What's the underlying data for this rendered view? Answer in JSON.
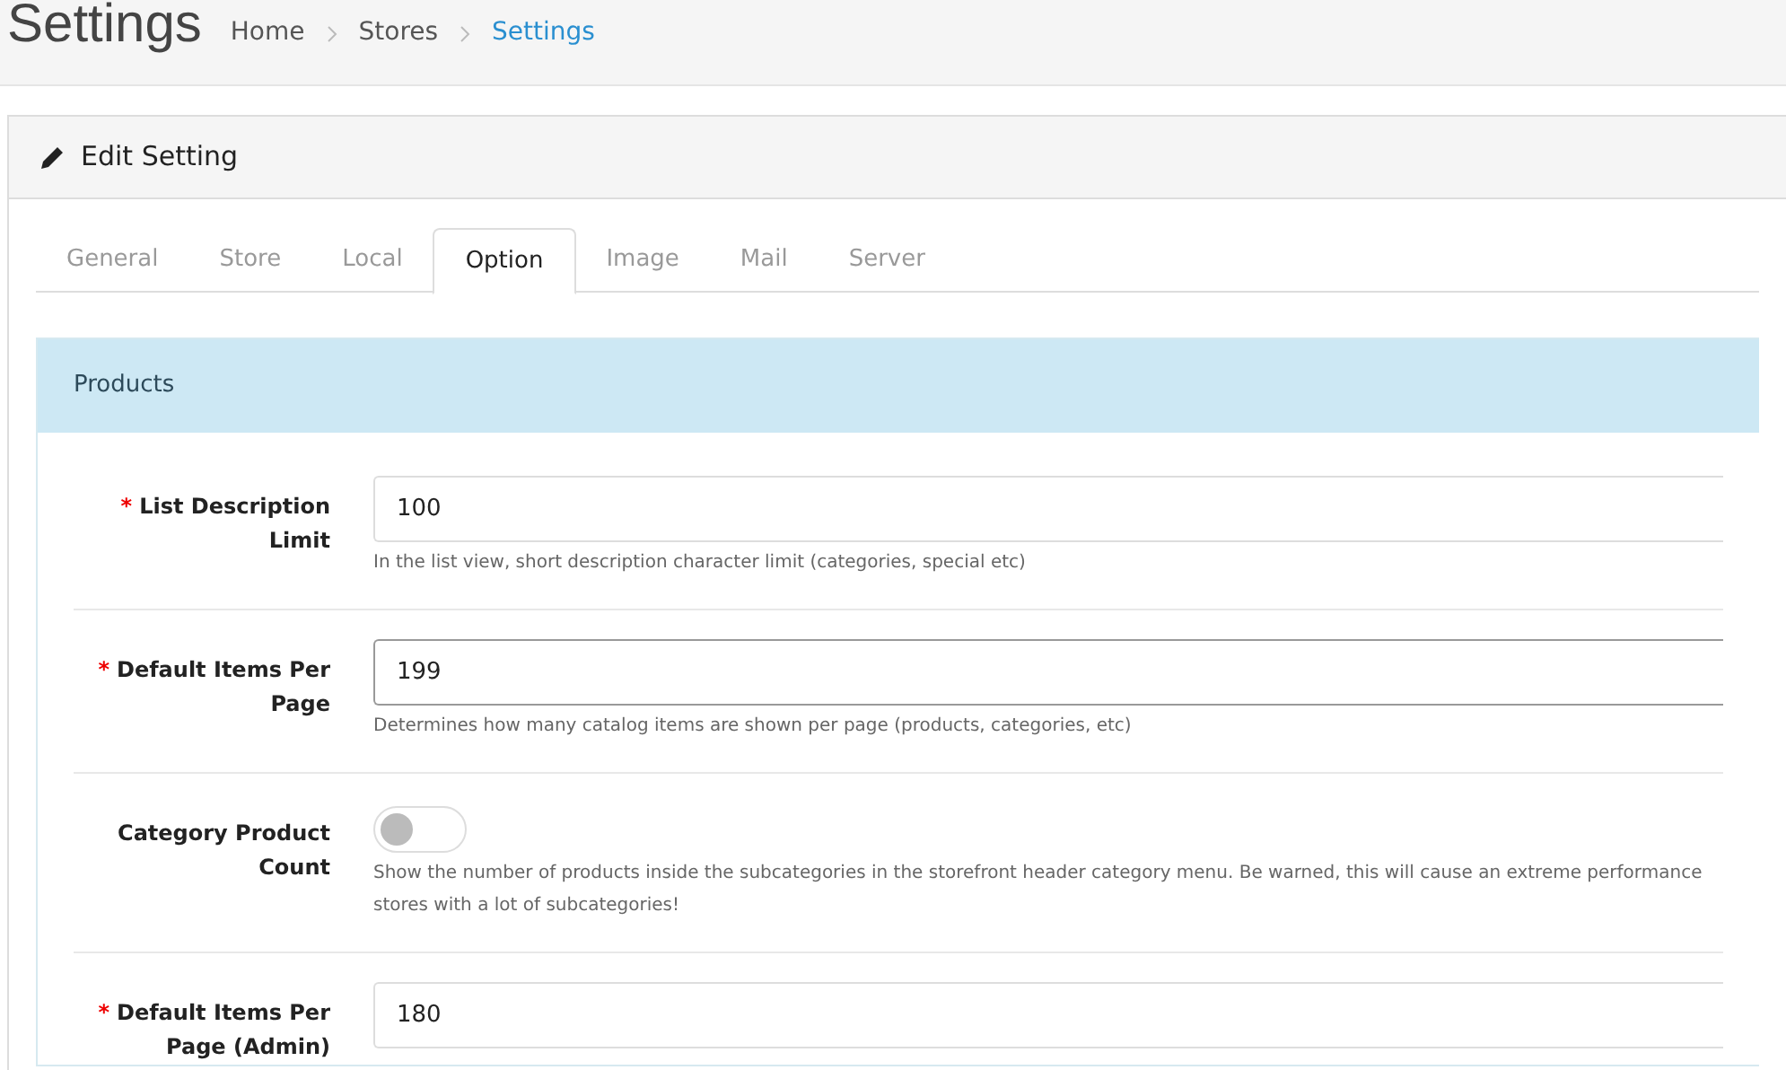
{
  "page_title": "Settings",
  "breadcrumb": [
    {
      "label": "Home",
      "selected": false
    },
    {
      "label": "Stores",
      "selected": false
    },
    {
      "label": "Settings",
      "selected": true
    }
  ],
  "panel": {
    "title": "Edit Setting"
  },
  "tabs": [
    {
      "label": "General",
      "selected": false
    },
    {
      "label": "Store",
      "selected": false
    },
    {
      "label": "Local",
      "selected": false
    },
    {
      "label": "Option",
      "selected": true
    },
    {
      "label": "Image",
      "selected": false
    },
    {
      "label": "Mail",
      "selected": false
    },
    {
      "label": "Server",
      "selected": false
    }
  ],
  "section": {
    "title": "Products"
  },
  "fields": [
    {
      "kind": "text",
      "label": "List Description Limit",
      "marker": "*",
      "value": "100",
      "focused": false,
      "help": [
        "In the list view, short description character limit (categories, special etc)"
      ]
    },
    {
      "kind": "text",
      "label": "Default Items Per Page",
      "marker": "*",
      "value": "199",
      "focused": true,
      "help": [
        "Determines how many catalog items are shown per page (products, categories, etc)"
      ]
    },
    {
      "kind": "toggle",
      "label": "Category Product Count",
      "on": false,
      "help": [
        "Show the number of products inside the subcategories in the storefront header category menu. Be warned, this will cause an extreme performance",
        "stores with a lot of subcategories!"
      ]
    },
    {
      "kind": "text",
      "label": "Default Items Per Page (Admin)",
      "marker": "*",
      "value": "180",
      "focused": false
    }
  ]
}
